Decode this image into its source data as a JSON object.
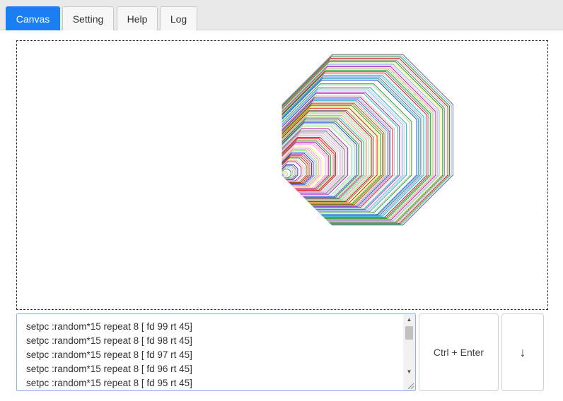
{
  "tabs": [
    {
      "label": "Canvas",
      "active": true
    },
    {
      "label": "Setting",
      "active": false
    },
    {
      "label": "Help",
      "active": false
    },
    {
      "label": "Log",
      "active": false
    }
  ],
  "editor": {
    "lines": [
      "setpc :random*15 repeat 8 [ fd 99 rt 45]",
      "setpc :random*15 repeat 8 [ fd 98 rt 45]",
      "setpc :random*15 repeat 8 [ fd 97 rt 45]",
      "setpc :random*15 repeat 8 [ fd 96 rt 45]",
      "setpc :random*15 repeat 8 [ fd 95 rt 45]"
    ]
  },
  "buttons": {
    "run_label": "Ctrl + Enter",
    "down_label": "↓"
  },
  "colors": {
    "accent": "#1a7ff0",
    "palette": [
      "#000000",
      "#1f3fd0",
      "#1aa51a",
      "#18b8c8",
      "#d81818",
      "#b020b0",
      "#a06818",
      "#c8c8c8",
      "#707070",
      "#8fa8ff",
      "#98e878",
      "#b8f0f8",
      "#ff9a9a",
      "#f0a0f0",
      "#fff060",
      "#ffffff"
    ]
  },
  "turtle": {
    "pen_colors": 15,
    "repeat": 8,
    "turn_degrees": 45,
    "max_forward": 99
  }
}
